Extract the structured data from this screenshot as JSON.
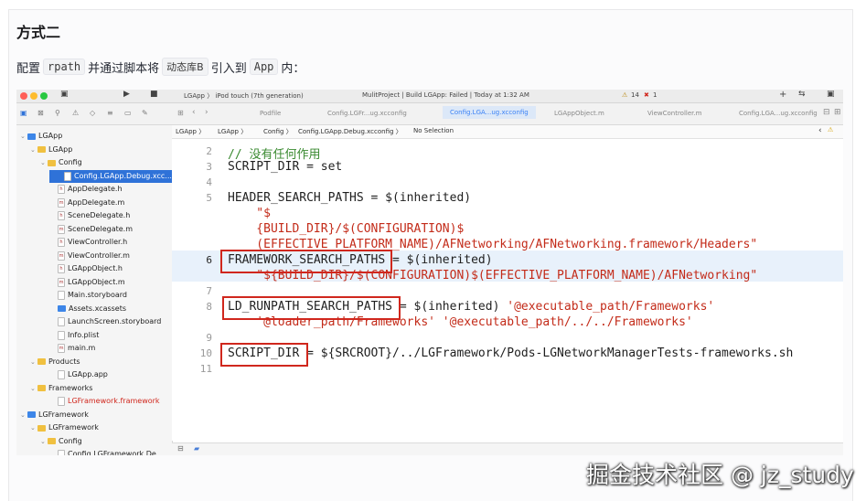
{
  "article": {
    "heading": "方式二",
    "para": {
      "t1": "配置",
      "c1": "rpath",
      "t2": "并通过脚本将",
      "c2": "动态库B",
      "t3": "引入到",
      "c3": "App",
      "t4": "内："
    }
  },
  "xcode": {
    "titlebar": {
      "scheme": "LGApp 〉 iPod touch (7th generation)",
      "status": "MulitProject | Build LGApp: Failed | Today at 1:32 AM",
      "warnings": "14",
      "errors": "1",
      "plus": "+",
      "arrows": "⇆"
    },
    "tabs": [
      "Podfile",
      "Config.LGFr...ug.xcconfig",
      "Config.LGA...ug.xcconfig",
      "LGAppObject.m",
      "ViewController.m",
      "Config.LGA...ug.xcconfig"
    ],
    "active_tab": 2,
    "navtools": [
      "▣",
      "⊠",
      "⚲",
      "⚠",
      "◇",
      "≡",
      "▭",
      "✎"
    ],
    "tree": [
      {
        "label": "LGApp",
        "indent": 0,
        "icon": "blue",
        "open": true
      },
      {
        "label": "LGApp",
        "indent": 1,
        "icon": "folder",
        "open": true
      },
      {
        "label": "Config",
        "indent": 2,
        "icon": "folder",
        "open": true
      },
      {
        "label": "Config.LGApp.Debug.xcc...",
        "indent": 3,
        "icon": "file",
        "sel": true
      },
      {
        "label": "AppDelegate.h",
        "indent": 3,
        "icon": "file",
        "letter": "h"
      },
      {
        "label": "AppDelegate.m",
        "indent": 3,
        "icon": "file",
        "letter": "m"
      },
      {
        "label": "SceneDelegate.h",
        "indent": 3,
        "icon": "file",
        "letter": "h"
      },
      {
        "label": "SceneDelegate.m",
        "indent": 3,
        "icon": "file",
        "letter": "m"
      },
      {
        "label": "ViewController.h",
        "indent": 3,
        "icon": "file",
        "letter": "h"
      },
      {
        "label": "ViewController.m",
        "indent": 3,
        "icon": "file",
        "letter": "m"
      },
      {
        "label": "LGAppObject.h",
        "indent": 3,
        "icon": "file",
        "letter": "h"
      },
      {
        "label": "LGAppObject.m",
        "indent": 3,
        "icon": "file",
        "letter": "m"
      },
      {
        "label": "Main.storyboard",
        "indent": 3,
        "icon": "file"
      },
      {
        "label": "Assets.xcassets",
        "indent": 3,
        "icon": "blue"
      },
      {
        "label": "LaunchScreen.storyboard",
        "indent": 3,
        "icon": "file"
      },
      {
        "label": "Info.plist",
        "indent": 3,
        "icon": "file"
      },
      {
        "label": "main.m",
        "indent": 3,
        "icon": "file",
        "letter": "m"
      },
      {
        "label": "Products",
        "indent": 1,
        "icon": "folder",
        "open": true
      },
      {
        "label": "LGApp.app",
        "indent": 3,
        "icon": "file"
      },
      {
        "label": "Frameworks",
        "indent": 1,
        "icon": "folder",
        "open": true
      },
      {
        "label": "LGFramework.framework",
        "indent": 3,
        "icon": "file",
        "red": true
      },
      {
        "label": "LGFramework",
        "indent": 0,
        "icon": "blue",
        "open": true
      },
      {
        "label": "LGFramework",
        "indent": 1,
        "icon": "folder",
        "open": true
      },
      {
        "label": "Config",
        "indent": 2,
        "icon": "folder",
        "open": true
      },
      {
        "label": "Config.LGFramework.De...",
        "indent": 3,
        "icon": "file"
      }
    ],
    "jumpbar": [
      "LGApp",
      "LGApp",
      "Config",
      "Config.LGApp.Debug.xcconfig",
      "No Selection"
    ],
    "code": [
      {
        "n": "2",
        "parts": [
          {
            "t": "// 没有任何作用",
            "c": "cm"
          }
        ]
      },
      {
        "n": "3",
        "parts": [
          {
            "t": "SCRIPT_DIR = set"
          }
        ]
      },
      {
        "n": "4",
        "parts": []
      },
      {
        "n": "5",
        "parts": [
          {
            "t": "HEADER_SEARCH_PATHS = $(inherited)"
          }
        ]
      },
      {
        "n": "",
        "parts": [
          {
            "t": "    \"$",
            "c": "str"
          }
        ]
      },
      {
        "n": "",
        "parts": [
          {
            "t": "    {BUILD_DIR}/$(CONFIGURATION)$",
            "c": "str"
          }
        ]
      },
      {
        "n": "",
        "parts": [
          {
            "t": "    (EFFECTIVE_PLATFORM_NAME)/AFNetworking/AFNetworking.framework/Headers\"",
            "c": "str"
          }
        ]
      },
      {
        "n": "6",
        "parts": [
          {
            "t": "FRAMEWORK_SEARCH_PATHS = $(inherited)"
          }
        ]
      },
      {
        "n": "",
        "parts": [
          {
            "t": "    \"${BUILD_DIR}/$(CONFIGURATION)$(EFFECTIVE_PLATFORM_NAME)/AFNetworking\"",
            "c": "str"
          }
        ]
      },
      {
        "n": "7",
        "parts": []
      },
      {
        "n": "8",
        "parts": [
          {
            "t": "LD_RUNPATH_SEARCH_PATHS = $(inherited) "
          },
          {
            "t": "'@executable_path/Frameworks'",
            "c": "str"
          }
        ]
      },
      {
        "n": "",
        "parts": [
          {
            "t": "    '@loader_path/Frameworks' '@executable_path/../../Frameworks'",
            "c": "str"
          }
        ]
      },
      {
        "n": "9",
        "parts": []
      },
      {
        "n": "10",
        "parts": [
          {
            "t": "SCRIPT_DIR = ${SRCROOT}/../LGFramework/Pods-LGNetworkManagerTests-frameworks.sh"
          }
        ]
      },
      {
        "n": "11",
        "parts": []
      }
    ]
  },
  "watermark": "掘金技术社区 @ jz_study"
}
